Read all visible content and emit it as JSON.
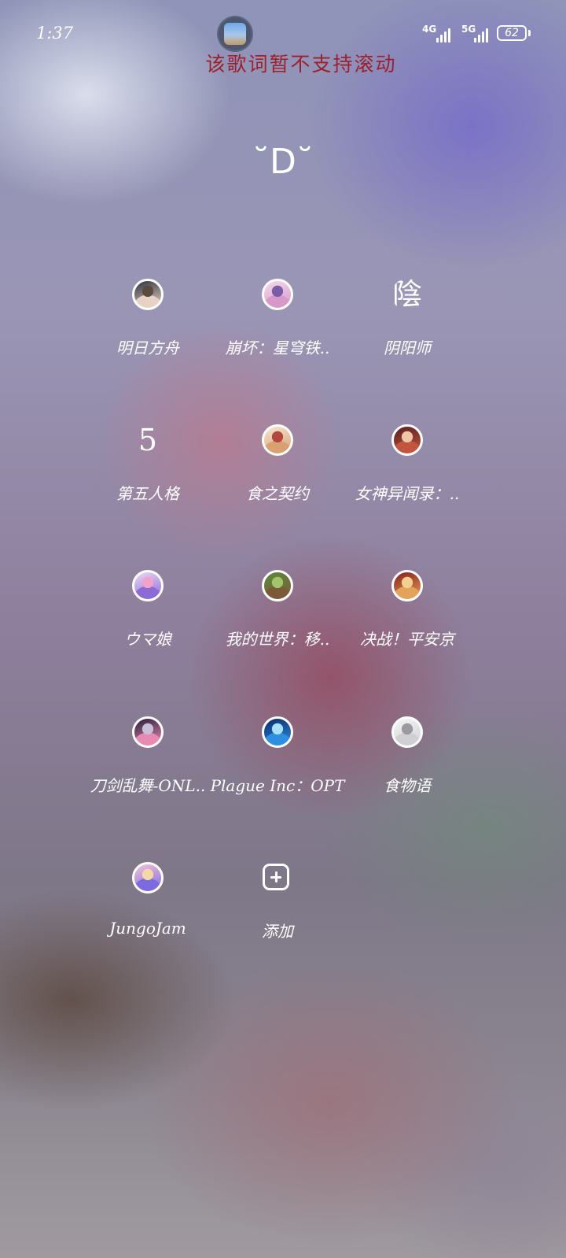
{
  "status_bar": {
    "time": "1:37",
    "network_1": "4G",
    "network_2": "5G",
    "battery_level": "62"
  },
  "lyric_banner": "该歌词暂不支持滚动",
  "face_emoticon": "˘D˘",
  "apps": [
    {
      "label": "明日方舟",
      "icon": "arknights-avatar-icon",
      "colors": [
        "#2d3340",
        "#e7d3c4",
        "#5b4a3e"
      ]
    },
    {
      "label": "崩坏：星穹铁..",
      "icon": "honkai-star-rail-avatar-icon",
      "colors": [
        "#f2d9ea",
        "#d79ac8",
        "#7b5aa8"
      ]
    },
    {
      "label": "阴阳师",
      "icon": "onmyoji-glyph-icon",
      "glyph": "陰"
    },
    {
      "label": "第五人格",
      "icon": "identity-v-glyph-icon",
      "glyph": "5"
    },
    {
      "label": "食之契约",
      "icon": "food-fantasy-avatar-icon",
      "colors": [
        "#f4e6d2",
        "#d9a072",
        "#b4473d"
      ]
    },
    {
      "label": "女神异闻录：..",
      "icon": "persona-avatar-icon",
      "colors": [
        "#5a1f1f",
        "#c2553f",
        "#f0c7a6"
      ]
    },
    {
      "label": "ウマ娘",
      "icon": "umamusume-avatar-icon",
      "colors": [
        "#e9d8f4",
        "#8c6ad8",
        "#f2a2c8"
      ]
    },
    {
      "label": "我的世界：移..",
      "icon": "minecraft-avatar-icon",
      "colors": [
        "#5d8a3a",
        "#7b5a3a",
        "#a3c46b"
      ]
    },
    {
      "label": "决战！平安京",
      "icon": "onmyoji-arena-avatar-icon",
      "colors": [
        "#8a1e1a",
        "#e4a35a",
        "#f2d08f"
      ]
    },
    {
      "label": "刀剑乱舞-ONL..",
      "icon": "touken-ranbu-avatar-icon",
      "colors": [
        "#2b1f3a",
        "#e78bb3",
        "#c9c0d8"
      ]
    },
    {
      "label": "Plague Inc：OPT",
      "icon": "plague-inc-avatar-icon",
      "colors": [
        "#0a2a6b",
        "#2f8ee0",
        "#a8e0ff"
      ]
    },
    {
      "label": "食物语",
      "icon": "food-language-avatar-icon",
      "colors": [
        "#f5f5f5",
        "#d0d0d4",
        "#9a9aa2"
      ]
    },
    {
      "label": "JungoJam",
      "icon": "jungojam-avatar-icon",
      "colors": [
        "#f2c2d6",
        "#7c6be0",
        "#f5d8a8"
      ]
    },
    {
      "label": "添加",
      "icon": "add-icon"
    }
  ]
}
